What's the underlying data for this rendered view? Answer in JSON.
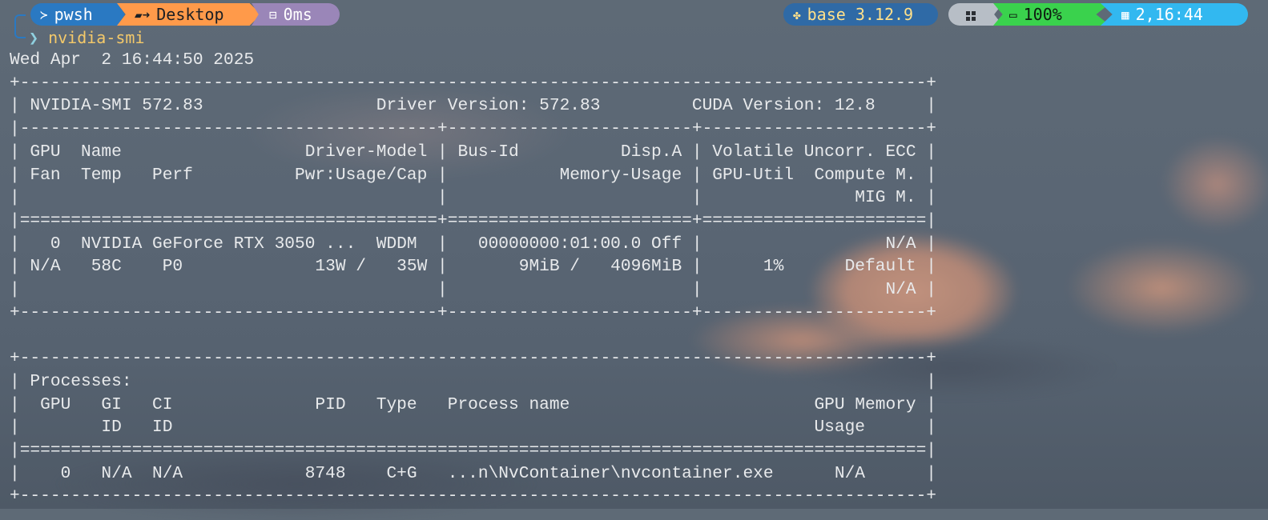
{
  "prompt": {
    "user": "pwsh",
    "path": "Desktop",
    "duration": "0ms",
    "python_env": "base 3.12.9",
    "battery": "100%",
    "clock": "2,16:44",
    "command": "nvidia-smi",
    "prompt_chevron": "❯"
  },
  "icons": {
    "user": "terminal-icon",
    "path": "folder-icon",
    "duration": "stopwatch-icon",
    "python": "python-icon",
    "os": "windows-icon",
    "battery": "battery-icon",
    "clock": "calendar-icon"
  },
  "colors": {
    "user_segment": "#2a79c2",
    "path_segment": "#ff9a4a",
    "duration_segment": "#9a86b8",
    "python_segment": "#2f6aa6",
    "battery_segment": "#3ad24d",
    "clock_segment": "#32b8f0",
    "command_text": "#f4c96a"
  },
  "output": {
    "lines": [
      "Wed Apr  2 16:44:50 2025",
      "+-----------------------------------------------------------------------------------------+",
      "| NVIDIA-SMI 572.83                 Driver Version: 572.83         CUDA Version: 12.8     |",
      "|-----------------------------------------+------------------------+----------------------+",
      "| GPU  Name                  Driver-Model | Bus-Id          Disp.A | Volatile Uncorr. ECC |",
      "| Fan  Temp   Perf          Pwr:Usage/Cap |           Memory-Usage | GPU-Util  Compute M. |",
      "|                                         |                        |               MIG M. |",
      "|=========================================+========================+======================|",
      "|   0  NVIDIA GeForce RTX 3050 ...  WDDM  |   00000000:01:00.0 Off |                  N/A |",
      "| N/A   58C    P0             13W /   35W |       9MiB /   4096MiB |      1%      Default |",
      "|                                         |                        |                  N/A |",
      "+-----------------------------------------+------------------------+----------------------+",
      "",
      "+-----------------------------------------------------------------------------------------+",
      "| Processes:                                                                              |",
      "|  GPU   GI   CI              PID   Type   Process name                        GPU Memory |",
      "|        ID   ID                                                               Usage      |",
      "|=========================================================================================|",
      "|    0   N/A  N/A            8748    C+G   ...n\\NvContainer\\nvcontainer.exe      N/A      |",
      "+-----------------------------------------------------------------------------------------+"
    ]
  }
}
